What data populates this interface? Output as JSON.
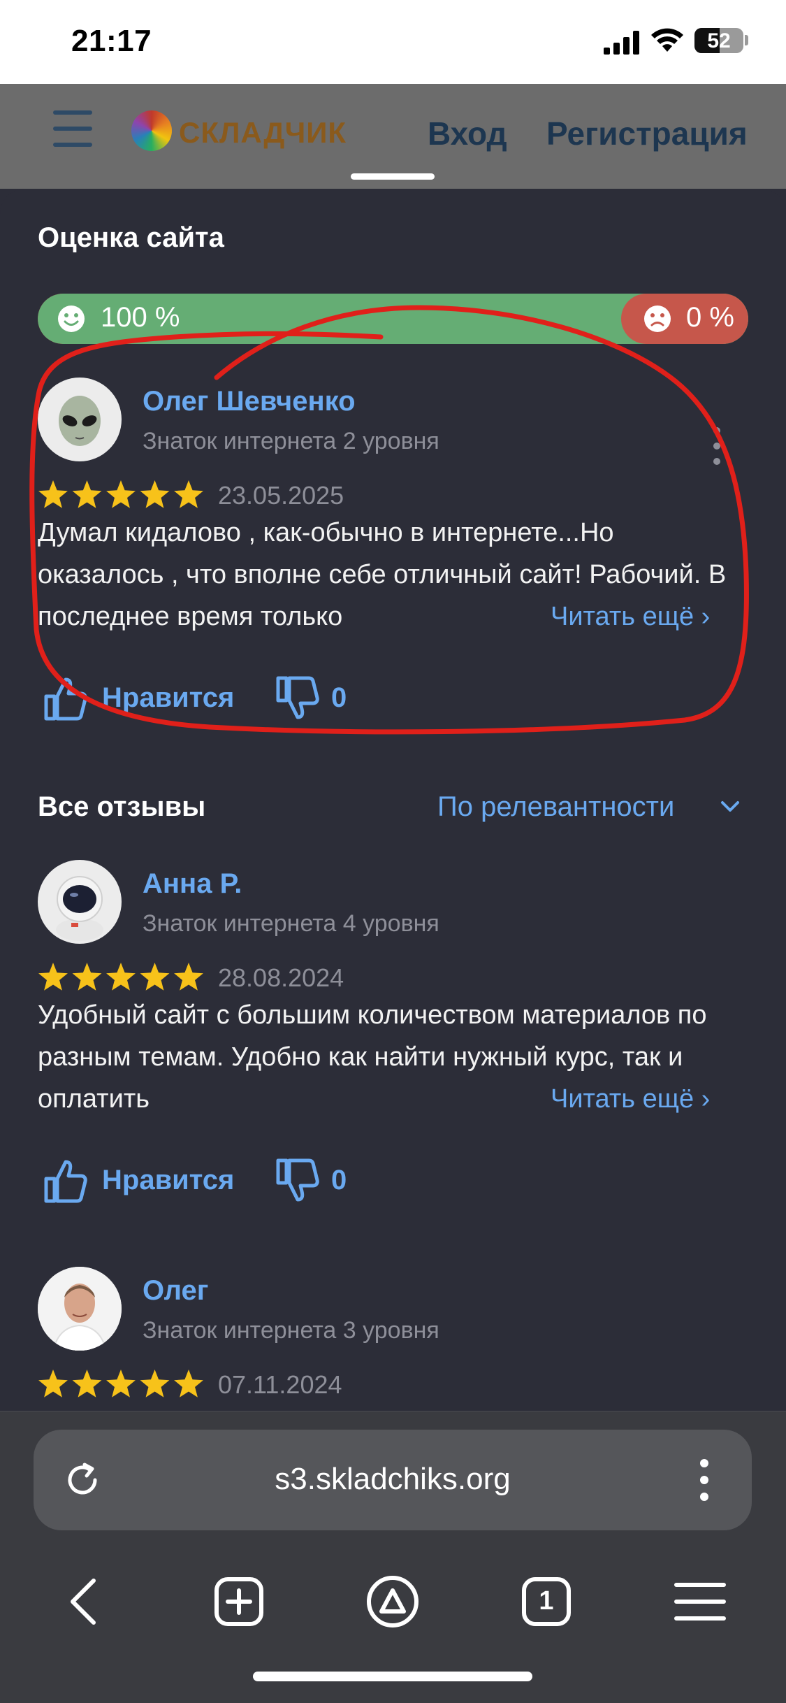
{
  "status_bar": {
    "time": "21:17",
    "battery": "52",
    "battery_level": 0.52
  },
  "site_header": {
    "logo_text": "СКЛАДЧИК",
    "login": "Вход",
    "register": "Регистрация"
  },
  "site_rating": {
    "title": "Оценка сайта",
    "positive_label": "100 %",
    "negative_label": "0 %",
    "positive_share": 1.0
  },
  "featured_review": {
    "name": "Олег Шевченко",
    "level": "Знаток интернета 2 уровня",
    "stars": 5,
    "date": "23.05.2025",
    "text": "Думал кидалово , как-обычно в интернете...Но оказалось , что вполне себе отличный сайт! Рабочий. В последнее время только",
    "read_more": "Читать ещё",
    "like_label": "Нравится",
    "dislike_count": "0",
    "avatar_icon": "alien-emoji"
  },
  "all_reviews": {
    "title": "Все отзывы",
    "sort_label": "По релевантности",
    "items": [
      {
        "name": "Анна Р.",
        "level": "Знаток интернета 4 уровня",
        "stars": 5,
        "date": "28.08.2024",
        "text": "Удобный сайт с большим количеством материалов по разным темам. Удобно как найти нужный курс, так и оплатить",
        "read_more": "Читать ещё",
        "like_label": "Нравится",
        "dislike_count": "0",
        "avatar_icon": "astronaut-emoji"
      },
      {
        "name": "Олег",
        "level": "Знаток интернета 3 уровня",
        "stars": 5,
        "date": "07.11.2024",
        "avatar_icon": "person-photo"
      }
    ]
  },
  "browser": {
    "url": "s3.skladchiks.org",
    "tab_count": "1"
  },
  "colors": {
    "background": "#2c2d38",
    "accent": "#6aa9f0",
    "positive": "#65ad74",
    "negative": "#c6574b",
    "star": "#f7c21a",
    "annotation": "#e0201a"
  }
}
